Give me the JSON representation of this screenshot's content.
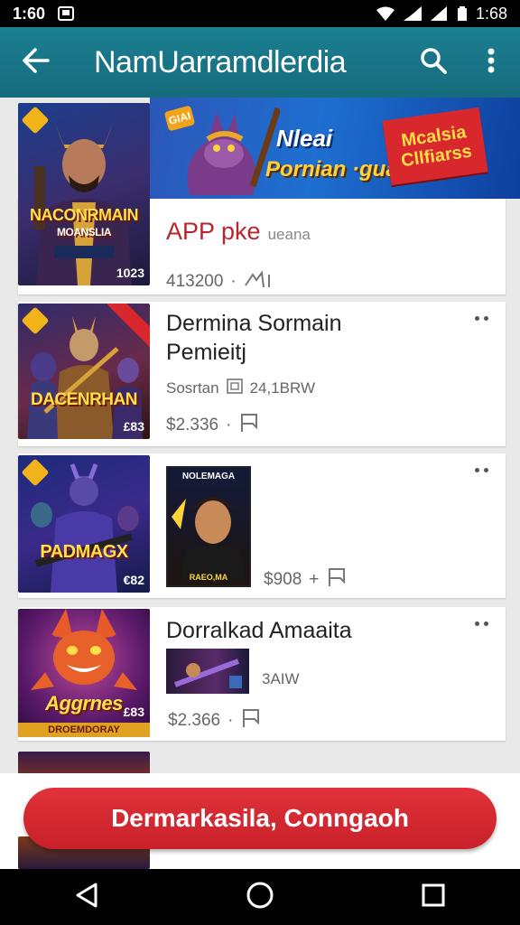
{
  "status": {
    "time_left": "1:60",
    "time_right": "1:68"
  },
  "app": {
    "title": "NamUarramdlerdia"
  },
  "banner": {
    "mark": "GIAI",
    "line1": "Nleai",
    "line2": "Pornian ·guaat",
    "badge": "Mcalsia\nCllfiarss"
  },
  "items": [
    {
      "thumb_title": "NACONRMAIN",
      "thumb_sub": "MOANSLIA",
      "thumb_price": "1023",
      "title": "APP pke",
      "subtitle": "ueana",
      "price": "413200",
      "sep": "·",
      "accent": "#b8262d"
    },
    {
      "thumb_title": "DACENRHAN",
      "thumb_price": "£83",
      "title": "Dermina Sormain Pemieitj",
      "label": "Sosrtan",
      "size": "24,1BRW",
      "price": "$2.336",
      "sep": "·"
    },
    {
      "thumb_title": "PADMAGX",
      "thumb_price": "€82",
      "mini_title": "NOLEMAGA",
      "mini_sub": "RAEO,MA",
      "price": "$908",
      "sep": "+"
    },
    {
      "thumb_title": "Aggrnes",
      "thumb_sub": "DROEMDORAY",
      "thumb_price": "£83",
      "title": "Dorralkad Amaaita",
      "size": "3AIW",
      "price": "$2.366",
      "sep": "·"
    }
  ],
  "cta": {
    "label": "Dermarkasila, Conngaoh"
  },
  "colors": {
    "app_bar": "#1c7f92",
    "cta": "#d8272d"
  }
}
